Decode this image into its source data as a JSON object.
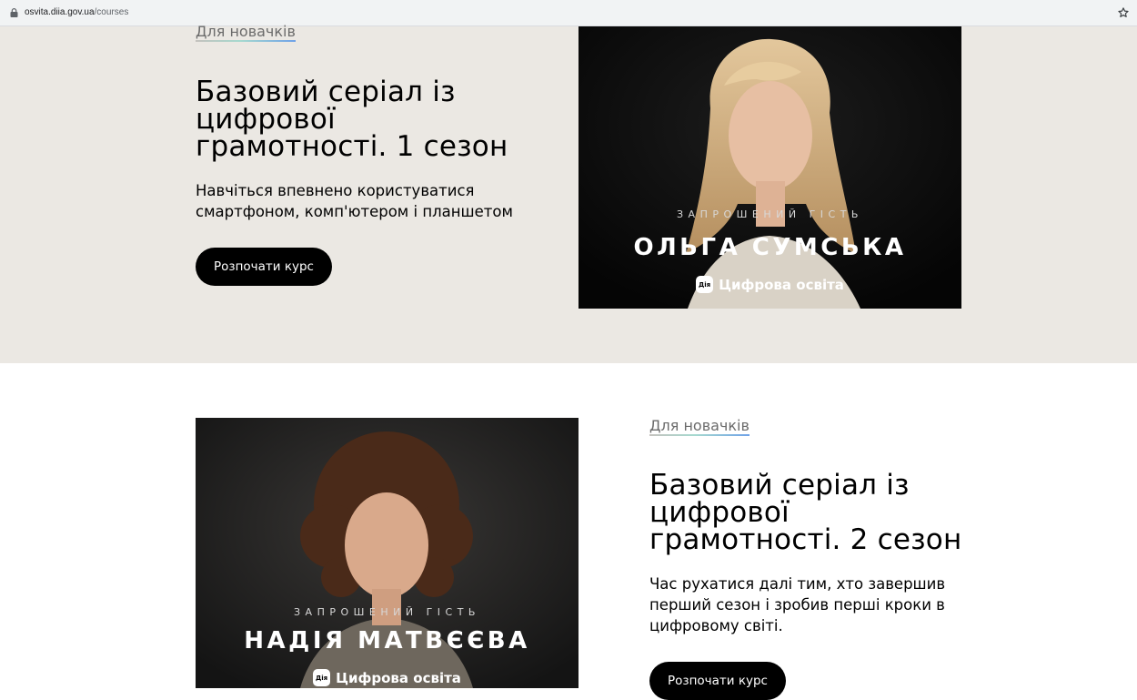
{
  "browser": {
    "url_domain": "osvita.diia.gov.ua",
    "url_path": "/courses"
  },
  "courses": [
    {
      "tag": "Для новачків",
      "title": "Базовий серіал із\nцифрової\nграмотності. 1 сезон",
      "description": "Навчіться впевнено користуватися\nсмартфоном, комп'ютером і планшетом",
      "button_label": "Розпочати курс",
      "image": {
        "guest_caption": "ЗАПРОШЕНИЙ ГІСТЬ",
        "guest_name": "ОЛЬГА СУМСЬКА",
        "logo_text": "Дія",
        "brand": "Цифрова освіта"
      }
    },
    {
      "tag": "Для новачків",
      "title": "Базовий серіал із\nцифрової\nграмотності. 2 сезон",
      "description": "Час рухатися далі тим, хто завершив\nперший сезон і зробив перші кроки в\nцифровому світі.",
      "button_label": "Розпочати курс",
      "image": {
        "guest_caption": "ЗАПРОШЕНИЙ ГІСТЬ",
        "guest_name": "НАДІЯ МАТВЄЄВА",
        "logo_text": "Дія",
        "brand": "Цифрова освіта"
      }
    }
  ],
  "colors": {
    "section_beige": "#ebe8e3",
    "button_bg": "#000000",
    "tag_underline": [
      "#c5c2be",
      "#a6d9cf",
      "#6fa2e8"
    ]
  }
}
